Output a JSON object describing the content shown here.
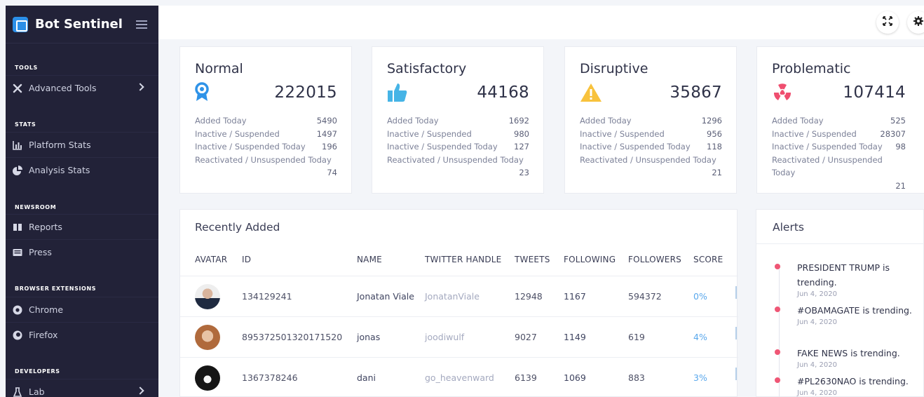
{
  "sidebar": {
    "brand": "Bot Sentinel",
    "sections": {
      "tools": "TOOLS",
      "stats": "STATS",
      "newsroom": "NEWSROOM",
      "browser_extensions": "BROWSER EXTENSIONS",
      "developers": "DEVELOPERS"
    },
    "items": {
      "advanced_tools": "Advanced Tools",
      "platform_stats": "Platform Stats",
      "analysis_stats": "Analysis Stats",
      "reports": "Reports",
      "press": "Press",
      "chrome": "Chrome",
      "firefox": "Firefox",
      "lab": "Lab"
    },
    "bg_color": "#222238"
  },
  "topbar": {
    "fullscreen_icon": "expand-icon",
    "settings_icon": "gear-icon"
  },
  "stats": [
    {
      "title": "Normal",
      "total": "222015",
      "icon": "ribbon-icon",
      "color": "#2f93e8",
      "rows": [
        {
          "label": "Added Today",
          "value": "5490"
        },
        {
          "label": "Inactive / Suspended",
          "value": "1497"
        },
        {
          "label": "Inactive / Suspended Today",
          "value": "196"
        }
      ],
      "reactivated_label": "Reactivated / Unsuspended Today",
      "reactivated_value": "74"
    },
    {
      "title": "Satisfactory",
      "total": "44168",
      "icon": "thumbs-up-icon",
      "color": "#46b4e6",
      "rows": [
        {
          "label": "Added Today",
          "value": "1692"
        },
        {
          "label": "Inactive / Suspended",
          "value": "980"
        },
        {
          "label": "Inactive / Suspended Today",
          "value": "127"
        }
      ],
      "reactivated_label": "Reactivated / Unsuspended Today",
      "reactivated_value": "23"
    },
    {
      "title": "Disruptive",
      "total": "35867",
      "icon": "warning-icon",
      "color": "#f8c23c",
      "rows": [
        {
          "label": "Added Today",
          "value": "1296"
        },
        {
          "label": "Inactive / Suspended",
          "value": "956"
        },
        {
          "label": "Inactive / Suspended Today",
          "value": "118"
        }
      ],
      "reactivated_label": "Reactivated / Unsuspended Today",
      "reactivated_value": "21"
    },
    {
      "title": "Problematic",
      "total": "107414",
      "icon": "radiation-icon",
      "color": "#ef4e6f",
      "rows": [
        {
          "label": "Added Today",
          "value": "525"
        },
        {
          "label": "Inactive / Suspended",
          "value": "28307"
        },
        {
          "label": "Inactive / Suspended Today",
          "value": "98"
        }
      ],
      "reactivated_label": "Reactivated / Unsuspended Today",
      "reactivated_value": "21"
    }
  ],
  "recent": {
    "title": "Recently Added",
    "headers": [
      "AVATAR",
      "ID",
      "NAME",
      "TWITTER HANDLE",
      "TWEETS",
      "FOLLOWING",
      "FOLLOWERS",
      "SCORE"
    ],
    "rows": [
      {
        "id": "134129241",
        "name": "Jonatan Viale",
        "handle": "JonatanViale",
        "tweets": "12948",
        "following": "1167",
        "followers": "594372",
        "score": "0%"
      },
      {
        "id": "895372501320171520",
        "name": "jonas",
        "handle": "joodiwulf",
        "tweets": "9027",
        "following": "1149",
        "followers": "619",
        "score": "4%"
      },
      {
        "id": "1367378246",
        "name": "dani",
        "handle": "go_heavenward",
        "tweets": "6139",
        "following": "1069",
        "followers": "883",
        "score": "3%"
      }
    ]
  },
  "alerts": {
    "title": "Alerts",
    "items": [
      {
        "text": "PRESIDENT TRUMP is trending.",
        "date": "Jun 4, 2020"
      },
      {
        "text": "#OBAMAGATE is trending.",
        "date": "Jun 4, 2020"
      },
      {
        "text": "FAKE NEWS is trending.",
        "date": "Jun 4, 2020"
      },
      {
        "text": "#PL2630NAO is trending.",
        "date": "Jun 4, 2020"
      }
    ]
  }
}
